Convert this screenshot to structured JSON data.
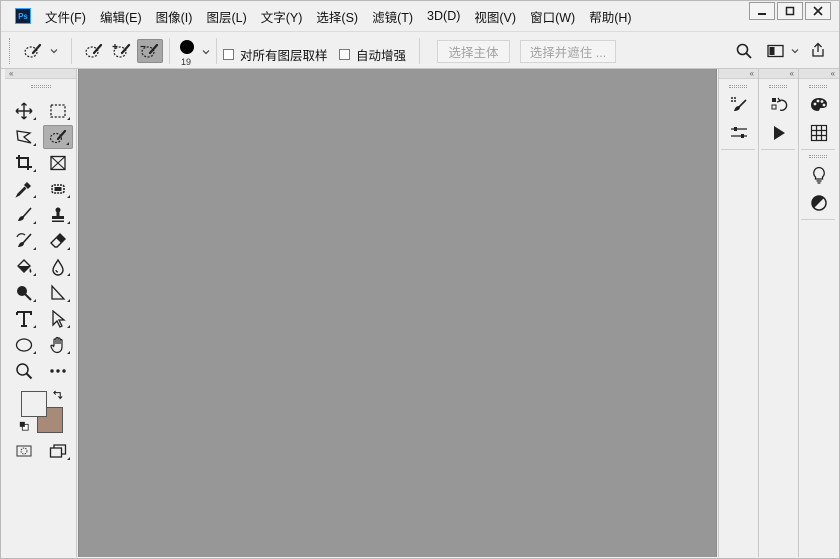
{
  "app": {
    "logo_text": "Ps"
  },
  "menu": [
    {
      "label": "文件(F)"
    },
    {
      "label": "编辑(E)"
    },
    {
      "label": "图像(I)"
    },
    {
      "label": "图层(L)"
    },
    {
      "label": "文字(Y)"
    },
    {
      "label": "选择(S)"
    },
    {
      "label": "滤镜(T)"
    },
    {
      "label": "3D(D)"
    },
    {
      "label": "视图(V)"
    },
    {
      "label": "窗口(W)"
    },
    {
      "label": "帮助(H)"
    }
  ],
  "window_controls": [
    "minimize-icon",
    "restore-icon",
    "close-icon"
  ],
  "options": {
    "brush_size": "19",
    "brush_color": "#000000",
    "sample_all_layers_label": "对所有图层取样",
    "sample_all_layers_checked": false,
    "auto_enhance_label": "自动增强",
    "auto_enhance_checked": false,
    "select_subject_label": "选择主体",
    "select_and_mask_label": "选择并遮住 ..."
  },
  "colors": {
    "foreground": "#f0f0f0",
    "background": "#a88a78",
    "canvas": "#979797",
    "chrome": "#f0f0f0"
  },
  "tools": [
    "move-tool-icon",
    "marquee-tool-icon",
    "lasso-tool-icon",
    "quick-selection-tool-icon",
    "crop-tool-icon",
    "frame-tool-icon",
    "eyedropper-tool-icon",
    "spot-healing-tool-icon",
    "brush-tool-icon",
    "clone-stamp-tool-icon",
    "history-brush-tool-icon",
    "eraser-tool-icon",
    "paint-bucket-tool-icon",
    "blur-tool-icon",
    "dodge-tool-icon",
    "pen-tool-icon",
    "type-tool-icon",
    "path-selection-tool-icon",
    "ellipse-tool-icon",
    "hand-tool-icon",
    "zoom-tool-icon",
    "more-tools-icon"
  ],
  "active_tool": "quick-selection-tool-icon",
  "right_panels": {
    "col1": [
      "brush-settings-icon",
      "adjustments-sliders-icon"
    ],
    "col2": [
      "history-icon",
      "actions-play-icon"
    ],
    "col3": [
      "color-palette-icon",
      "swatches-grid-icon",
      "learn-lightbulb-icon",
      "adjustments-icon"
    ]
  }
}
